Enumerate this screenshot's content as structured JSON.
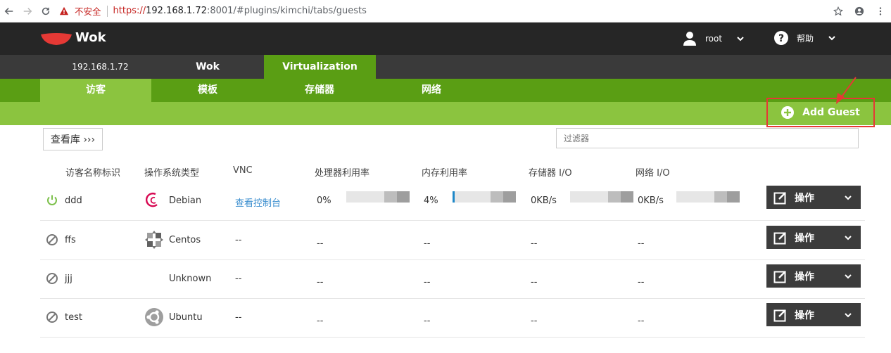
{
  "browser": {
    "insecure_label": "不安全",
    "url_scheme": "https://",
    "url_host": "192.168.1.72",
    "url_rest": ":8001/#plugins/kimchi/tabs/guests"
  },
  "header": {
    "brand": "Wok",
    "user": "root",
    "help": "帮助"
  },
  "host_tabs": [
    {
      "label": "192.168.1.72"
    },
    {
      "label": "Wok"
    },
    {
      "label": "Virtualization"
    }
  ],
  "sub_tabs": [
    {
      "label": "访客"
    },
    {
      "label": "模板"
    },
    {
      "label": "存储器"
    },
    {
      "label": "网络"
    }
  ],
  "add_guest_label": "Add Guest",
  "library_button": "查看库 ›››",
  "filter_placeholder": "过滤器",
  "columns": [
    "访客名称标识",
    "操作系统类型",
    "VNC",
    "处理器利用率",
    "内存利用率",
    "存储器 I/O",
    "网络 I/O"
  ],
  "op_label": "操作",
  "guests": [
    {
      "name": "ddd",
      "status": "running",
      "os": "Debian",
      "os_icon": "debian-icon",
      "vnc": "查看控制台",
      "cpu": "0%",
      "cpu_pct": 0,
      "mem": "4%",
      "mem_pct": 4,
      "storage": "0KB/s",
      "network": "0KB/s"
    },
    {
      "name": "ffs",
      "status": "shutoff",
      "os": "Centos",
      "os_icon": "centos-icon",
      "vnc": "--",
      "cpu": "--",
      "mem": "--",
      "storage": "--",
      "network": "--"
    },
    {
      "name": "jjj",
      "status": "shutoff",
      "os": "Unknown",
      "os_icon": "",
      "vnc": "--",
      "cpu": "--",
      "mem": "--",
      "storage": "--",
      "network": "--"
    },
    {
      "name": "test",
      "status": "shutoff",
      "os": "Ubuntu",
      "os_icon": "ubuntu-icon",
      "vnc": "--",
      "cpu": "--",
      "mem": "--",
      "storage": "--",
      "network": "--"
    }
  ],
  "colors": {
    "green_dark": "#5a9e14",
    "green_light": "#8bc43f",
    "header": "#262626",
    "accent_red": "#e53935"
  }
}
